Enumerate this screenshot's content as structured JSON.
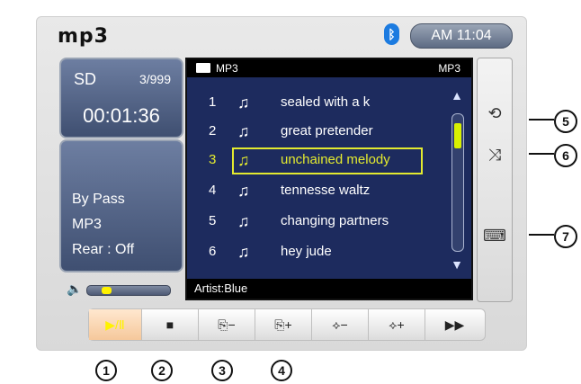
{
  "header": {
    "app_title": "mp3",
    "clock": "AM 11:04",
    "bluetooth_icon": "bluetooth-icon"
  },
  "source_panel": {
    "label": "SD",
    "track_count": "3/999",
    "elapsed": "00:01:36"
  },
  "info_panel": {
    "line1": "By Pass",
    "line2": "MP3",
    "line3": "Rear : Off"
  },
  "volume": {
    "level": 0.15
  },
  "list": {
    "header_left": "MP3",
    "header_right": "MP3",
    "rows": [
      {
        "num": "1",
        "title": "sealed with a k"
      },
      {
        "num": "2",
        "title": "great pretender"
      },
      {
        "num": "3",
        "title": "unchained melody",
        "selected": true
      },
      {
        "num": "4",
        "title": "tennesse waltz"
      },
      {
        "num": "5",
        "title": "changing partners"
      },
      {
        "num": "6",
        "title": "hey jude"
      }
    ],
    "footer": "Artist:Blue"
  },
  "side_buttons": [
    {
      "name": "repeat-icon",
      "glyph": "⟲"
    },
    {
      "name": "shuffle-icon",
      "glyph": "⤨"
    },
    {
      "name": "keyboard-icon",
      "glyph": "⌨"
    }
  ],
  "bottom_buttons": [
    {
      "name": "play-pause-button",
      "glyph": "▶/Ⅱ",
      "active": true
    },
    {
      "name": "stop-button",
      "glyph": "■"
    },
    {
      "name": "prev-folder-button",
      "glyph": "⎘−"
    },
    {
      "name": "next-folder-button",
      "glyph": "⎘+"
    },
    {
      "name": "prev-disc-button",
      "glyph": "⟡−"
    },
    {
      "name": "next-disc-button",
      "glyph": "⟡+"
    },
    {
      "name": "fast-forward-button",
      "glyph": "▶▶"
    }
  ],
  "callouts_bottom": [
    "1",
    "2",
    "3",
    "4"
  ],
  "callouts_side": [
    "5",
    "6",
    "7"
  ]
}
